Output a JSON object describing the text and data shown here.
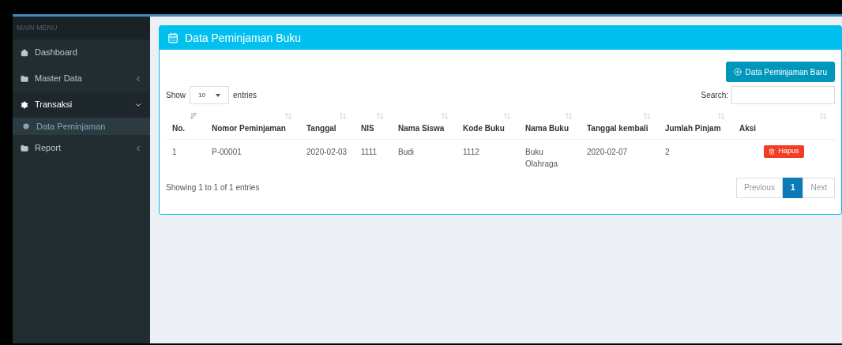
{
  "sidebar": {
    "header": "MAIN MENU",
    "items": [
      {
        "label": "Dashboard"
      },
      {
        "label": "Master Data",
        "expanded": false
      },
      {
        "label": "Transaksi",
        "expanded": true,
        "children": [
          {
            "label": "Data Peminjaman",
            "selected": true
          }
        ]
      },
      {
        "label": "Report",
        "expanded": false
      }
    ]
  },
  "panel": {
    "title": "Data Peminjaman Buku",
    "add_button": "Data Peminjaman Baru",
    "length": {
      "before": "Show",
      "value": "10",
      "after": "entries"
    },
    "search": {
      "label": "Search:"
    },
    "table": {
      "columns": [
        {
          "label": "No.",
          "sorted": true
        },
        {
          "label": "Nomor Peminjaman",
          "sorted": false
        },
        {
          "label": "Tanggal",
          "sorted": false
        },
        {
          "label": "NIS",
          "sorted": false
        },
        {
          "label": "Nama Siswa",
          "sorted": false
        },
        {
          "label": "Kode Buku",
          "sorted": false
        },
        {
          "label": "Nama Buku",
          "sorted": false
        },
        {
          "label": "Tanggal kembali",
          "sorted": false
        },
        {
          "label": "Jumlah Pinjam",
          "sorted": false
        },
        {
          "label": "Aksi",
          "sorted": false
        }
      ],
      "rows": [
        {
          "cells": [
            "1",
            "P-00001",
            "2020-02-03",
            "1111",
            "Budi",
            "1112",
            "Buku Olahraga",
            "2020-02-07",
            "2"
          ],
          "action": "Hapus"
        }
      ]
    },
    "info": "Showing 1 to 1 of 1 entries",
    "pagination": [
      {
        "label": "Previous",
        "selected": false
      },
      {
        "label": "1",
        "selected": true
      },
      {
        "label": "Next",
        "selected": false
      }
    ]
  }
}
